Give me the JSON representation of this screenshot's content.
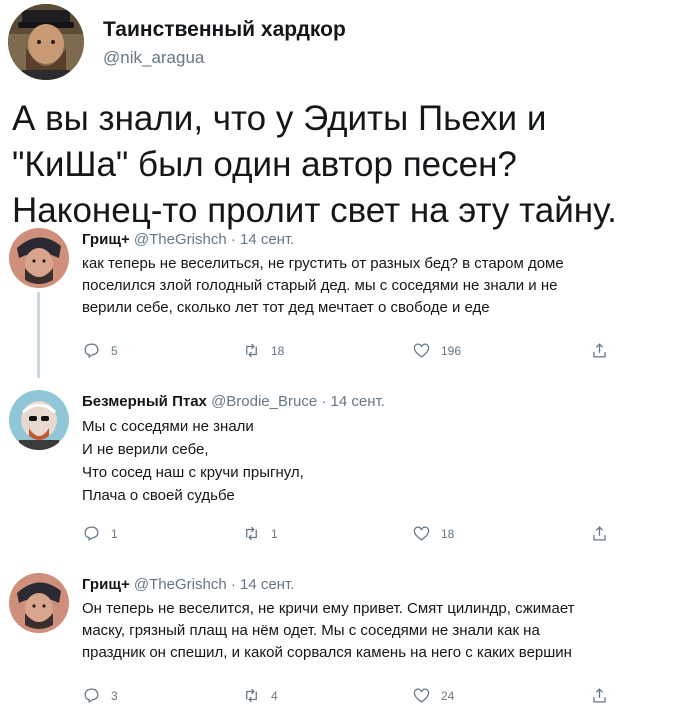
{
  "author": {
    "name": "Таинственный хардкор",
    "handle": "@nik_aragua"
  },
  "tweet": {
    "lines": [
      "А вы знали, что у Эдиты Пьехи и",
      "\"КиШа\" был один автор песен?",
      "Наконец-то пролит свет на эту тайну."
    ]
  },
  "replies": [
    {
      "name": "Грищ+",
      "handle": "@TheGrishch · 14 сент.",
      "lines": [
        "как теперь не веселиться, не грустить от разных бед? в старом доме",
        "поселился злой голодный старый дед. мы с соседями не знали и не",
        "верили себе, сколько лет тот дед мечтает о свободе и еде"
      ],
      "replies_count": "5",
      "retweets_count": "18",
      "likes_count": "196"
    },
    {
      "name": "Безмерный Птах",
      "handle": "@Brodie_Bruce · 14 сент.",
      "lines": [
        "Мы с соседями не знали",
        "И не верили себе,",
        "Что сосед наш с кручи прыгнул,",
        "Плача о своей судьбе"
      ],
      "replies_count": "1",
      "retweets_count": "1",
      "likes_count": "18"
    },
    {
      "name": "Грищ+",
      "handle": "@TheGrishch · 14 сент.",
      "lines": [
        "Он теперь не веселится, не кричи ему привет. Смят цилиндр, сжимает",
        "маску, грязный плащ на нём одет. Мы с соседями не знали как на",
        "праздник он спешил, и какой сорвался камень на него с каких вершин"
      ],
      "replies_count": "3",
      "retweets_count": "4",
      "likes_count": "24"
    }
  ],
  "icons": {
    "reply": "reply-icon",
    "retweet": "retweet-icon",
    "like": "like-icon",
    "share": "share-icon"
  },
  "colors": {
    "text": "#14171a",
    "muted": "#657786",
    "thread_line": "#ccd6dd"
  }
}
